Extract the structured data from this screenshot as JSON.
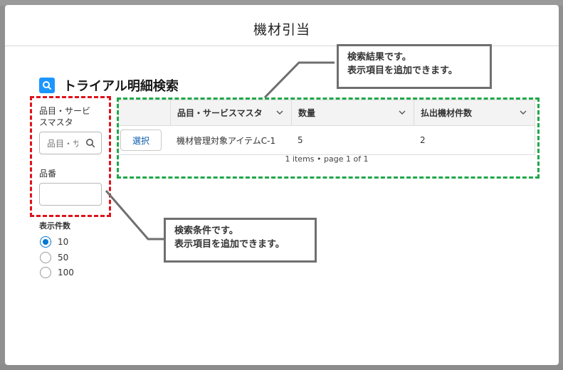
{
  "modal": {
    "title": "機材引当"
  },
  "search": {
    "section_title": "トライアル明細検索",
    "product_label": "品目・サービ\nスマスタ",
    "product_placeholder": "品目・サービスマスタ",
    "item_no_label": "品番",
    "item_no_value": "",
    "page_size_label": "表示件数",
    "page_size_options": [
      {
        "label": "10",
        "selected": true
      },
      {
        "label": "50",
        "selected": false
      },
      {
        "label": "100",
        "selected": false
      }
    ]
  },
  "results": {
    "columns": [
      "品目・サービスマスタ",
      "数量",
      "払出機材件数"
    ],
    "rows": [
      {
        "action": "選択",
        "product": "機材管理対象アイテムC-1",
        "quantity": "5",
        "issued": "2"
      }
    ],
    "pager": "1 items • page 1 of 1"
  },
  "callouts": {
    "results_line1": "検索結果です。",
    "results_line2": "表示項目を追加できます。",
    "conditions_line1": "検索条件です。",
    "conditions_line2": "表示項目を追加できます。"
  },
  "colors": {
    "accent": "#0176d3",
    "conditions_box": "#e0121a",
    "results_box": "#1fa84a",
    "callout_border": "#6f6f6f"
  },
  "icons": [
    "search-icon",
    "chevron-down-icon"
  ]
}
